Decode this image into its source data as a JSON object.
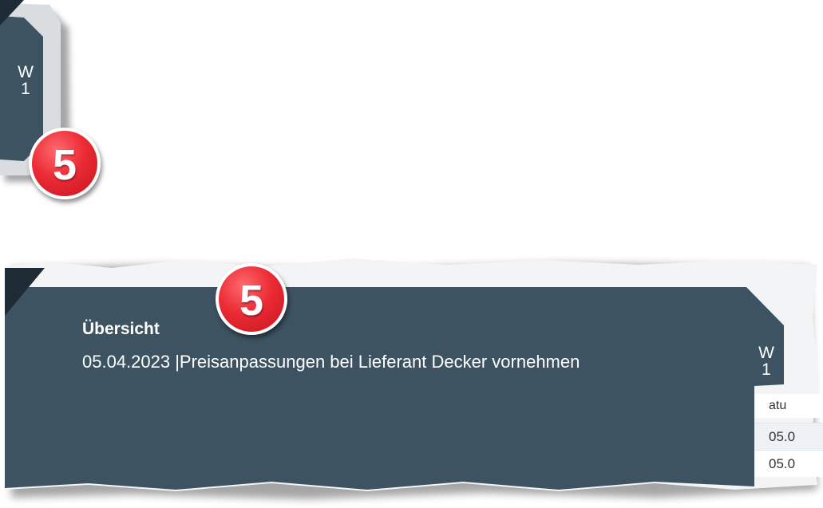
{
  "top_clip": {
    "tab_label_line1": "W",
    "tab_label_line2": "1",
    "step_number": "5"
  },
  "bottom_clip": {
    "step_number": "5",
    "section_title": "Übersicht",
    "subtitle": "05.04.2023 |Preisanpassungen bei Lieferant Decker vornehmen",
    "tab_label_line1": "W",
    "tab_label_line2": "1",
    "table": {
      "header": "atu",
      "rows": [
        "05.0",
        "05.0"
      ]
    }
  },
  "colors": {
    "panel": "#3d5361",
    "panel_dark": "#2a3945",
    "badge": "#e8232e"
  }
}
